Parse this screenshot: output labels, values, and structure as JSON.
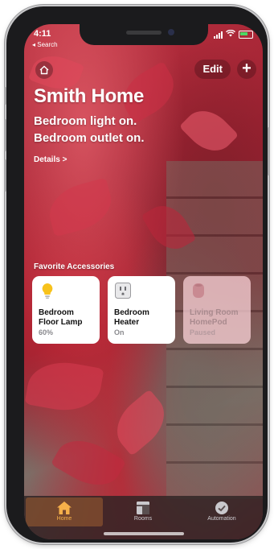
{
  "status_bar": {
    "time": "4:11",
    "back_label": "◂ Search"
  },
  "header": {
    "edit_label": "Edit",
    "add_label": "+"
  },
  "home": {
    "title": "Smith Home",
    "status_lines": [
      "Bedroom light on.",
      "Bedroom outlet on."
    ],
    "details_label": "Details >"
  },
  "favorites": {
    "header": "Favorite Accessories",
    "items": [
      {
        "name_line1": "Bedroom",
        "name_line2": "Floor Lamp",
        "state": "60%",
        "icon": "lightbulb-icon",
        "on": true
      },
      {
        "name_line1": "Bedroom",
        "name_line2": "Heater",
        "state": "On",
        "icon": "outlet-icon",
        "on": true
      },
      {
        "name_line1": "Living Room",
        "name_line2": "HomePod",
        "state": "Paused",
        "icon": "homepod-icon",
        "on": false
      }
    ]
  },
  "tabbar": {
    "tabs": [
      {
        "label": "Home",
        "icon": "house-icon",
        "active": true
      },
      {
        "label": "Rooms",
        "icon": "rooms-icon",
        "active": false
      },
      {
        "label": "Automation",
        "icon": "automation-icon",
        "active": false
      }
    ]
  },
  "colors": {
    "accent": "#f6b04a",
    "bulb": "#f7c21c",
    "tile_bg": "#ffffff"
  }
}
